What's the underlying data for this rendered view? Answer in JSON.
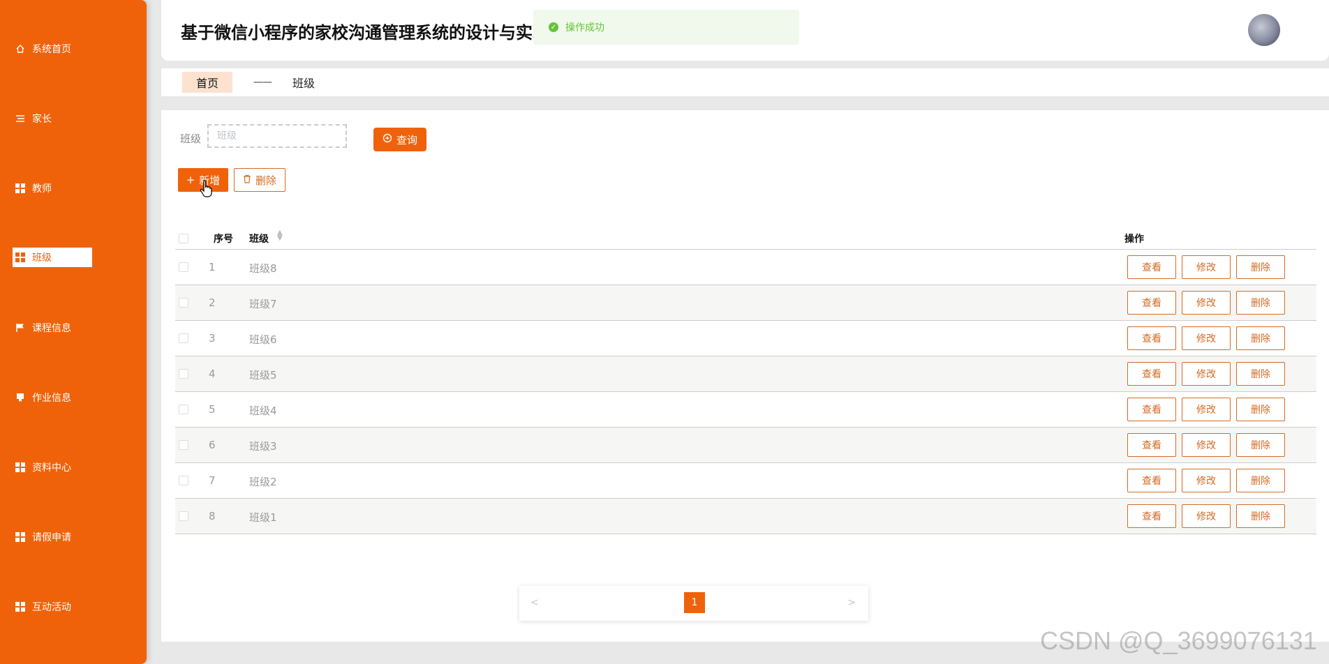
{
  "sidebar": {
    "items": [
      {
        "label": "系统首页",
        "icon": "home-icon"
      },
      {
        "label": "家长",
        "icon": "menu-lines-icon"
      },
      {
        "label": "教师",
        "icon": "grid-icon"
      },
      {
        "label": "班级",
        "icon": "grid-icon",
        "active": true
      },
      {
        "label": "课程信息",
        "icon": "flag-icon"
      },
      {
        "label": "作业信息",
        "icon": "book-icon"
      },
      {
        "label": "资料中心",
        "icon": "grid-icon"
      },
      {
        "label": "请假申请",
        "icon": "grid-icon"
      },
      {
        "label": "互动活动",
        "icon": "grid-icon"
      }
    ]
  },
  "header": {
    "title": "基于微信小程序的家校沟通管理系统的设计与实现",
    "toast": "操作成功"
  },
  "breadcrumb": {
    "home": "首页",
    "separator": "——",
    "current": "班级"
  },
  "search": {
    "label": "班级",
    "placeholder": "班级",
    "query_label": "查询"
  },
  "actions": {
    "add_label": "新增",
    "delete_label": "删除"
  },
  "table": {
    "headers": {
      "index": "序号",
      "name": "班级",
      "ops": "操作"
    },
    "rows": [
      {
        "index": "1",
        "name": "班级8"
      },
      {
        "index": "2",
        "name": "班级7"
      },
      {
        "index": "3",
        "name": "班级6"
      },
      {
        "index": "4",
        "name": "班级5"
      },
      {
        "index": "5",
        "name": "班级4"
      },
      {
        "index": "6",
        "name": "班级3"
      },
      {
        "index": "7",
        "name": "班级2"
      },
      {
        "index": "8",
        "name": "班级1"
      }
    ],
    "row_actions": {
      "view": "查看",
      "edit": "修改",
      "delete": "删除"
    }
  },
  "pagination": {
    "prev": "<",
    "current": "1",
    "next": ">"
  },
  "watermark": "CSDN @Q_3699076131",
  "colors": {
    "accent": "#f0620a",
    "success": "#67c23a",
    "outline": "#d46b24"
  }
}
